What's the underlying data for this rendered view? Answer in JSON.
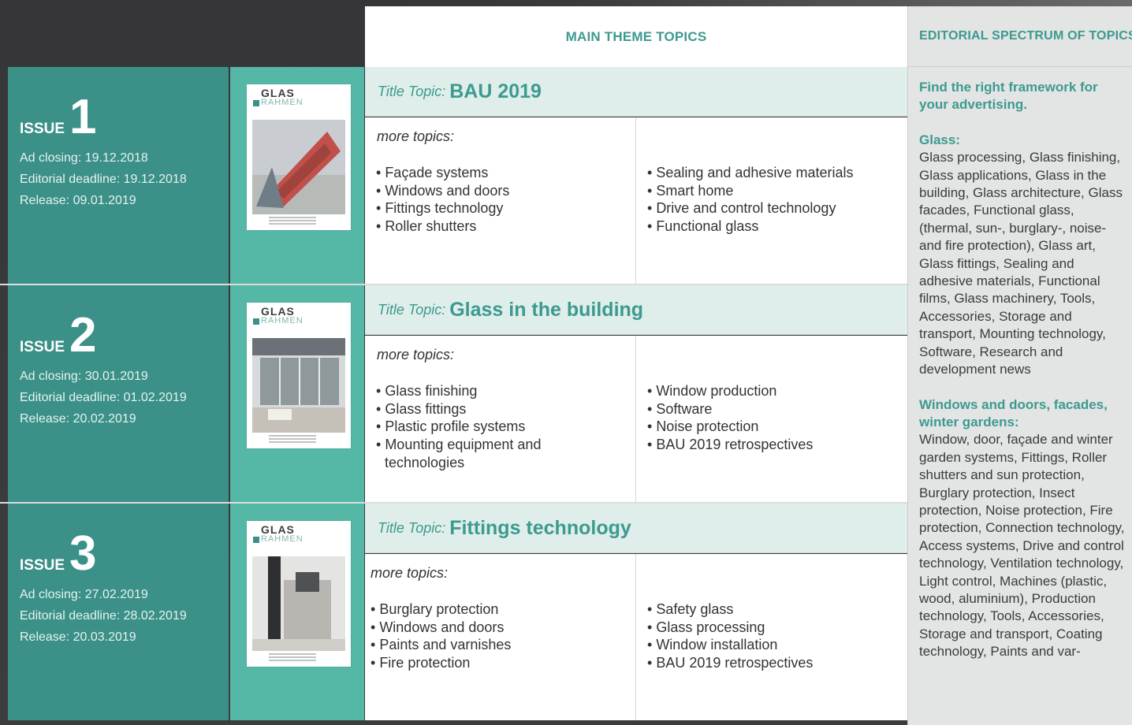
{
  "header": {
    "main_theme": "MAIN THEME TOPICS",
    "editorial_spectrum": "EDITORIAL SPECTRUM OF TOPICS"
  },
  "issues": [
    {
      "word": "ISSUE",
      "number": "1",
      "ad_closing": "Ad closing: 19.12.2018",
      "editorial_deadline": "Editorial deadline: 19.12.2018",
      "release": "Release: 09.01.2019",
      "cover_logo_top": "GLAS",
      "cover_logo_bottom": "RAHMEN",
      "title_prefix": "Title Topic:",
      "title": "BAU 2019",
      "more_label": "more topics:",
      "topics_left": [
        "Façade systems",
        "Windows and doors",
        "Fittings technology",
        "Roller shutters"
      ],
      "topics_right": [
        "Sealing and adhesive materials",
        "Smart home",
        "Drive and control technology",
        "Functional glass"
      ]
    },
    {
      "word": "ISSUE",
      "number": "2",
      "ad_closing": "Ad closing: 30.01.2019",
      "editorial_deadline": "Editorial deadline: 01.02.2019",
      "release": "Release: 20.02.2019",
      "cover_logo_top": "GLAS",
      "cover_logo_bottom": "RAHMEN",
      "title_prefix": "Title Topic:",
      "title": "Glass in the building",
      "more_label": "more topics:",
      "topics_left": [
        "Glass finishing",
        "Glass fittings",
        "Plastic profile systems",
        "Mounting equipment and technologies"
      ],
      "topics_right": [
        "Window production",
        "Software",
        "Noise protection",
        "BAU 2019 retrospectives"
      ]
    },
    {
      "word": "ISSUE",
      "number": "3",
      "ad_closing": "Ad closing: 27.02.2019",
      "editorial_deadline": "Editorial deadline: 28.02.2019",
      "release": "Release: 20.03.2019",
      "cover_logo_top": "GLAS",
      "cover_logo_bottom": "RAHMEN",
      "title_prefix": "Title Topic:",
      "title": "Fittings technology",
      "more_label": "more topics:",
      "topics_left": [
        "Burglary protection",
        "Windows and doors",
        "Paints and varnishes",
        "Fire protection"
      ],
      "topics_right": [
        "Safety glass",
        "Glass processing",
        "Window installation",
        "BAU 2019 retrospectives"
      ]
    }
  ],
  "spectrum": {
    "lead": "Find the right framework for your advertising.",
    "sections": [
      {
        "heading": "Glass:",
        "text": "Glass processing, Glass finishing, Glass applications, Glass in the building, Glass architecture, Glass facades, Functional glass, (thermal, sun-, burglary-, noise- and fire protection), Glass art, Glass fittings, Sealing and adhesive materials, Functional films, Glass machinery, Tools, Accessories, Storage and transport, Mounting technology, Software, Research and development news"
      },
      {
        "heading": "Windows and doors, facades, winter gardens:",
        "text": "Window, door, façade and winter garden systems, Fittings, Roller shutters and sun protection, Burglary protection, Insect protection, Noise protection, Fire protection, Connection technology, Access systems, Drive and control technology, Ventilation technology, Light control, Machines (plastic, wood, aluminium), Production technology, Tools, Accessories, Storage and transport, Coating technology, Paints and var-"
      }
    ]
  },
  "colors": {
    "accent": "#3c9a8f",
    "issue_panel": "#3b9087",
    "cover_panel": "#55b7a6",
    "title_band": "#dfeeea",
    "spectrum_bg": "#e3e4e4"
  }
}
